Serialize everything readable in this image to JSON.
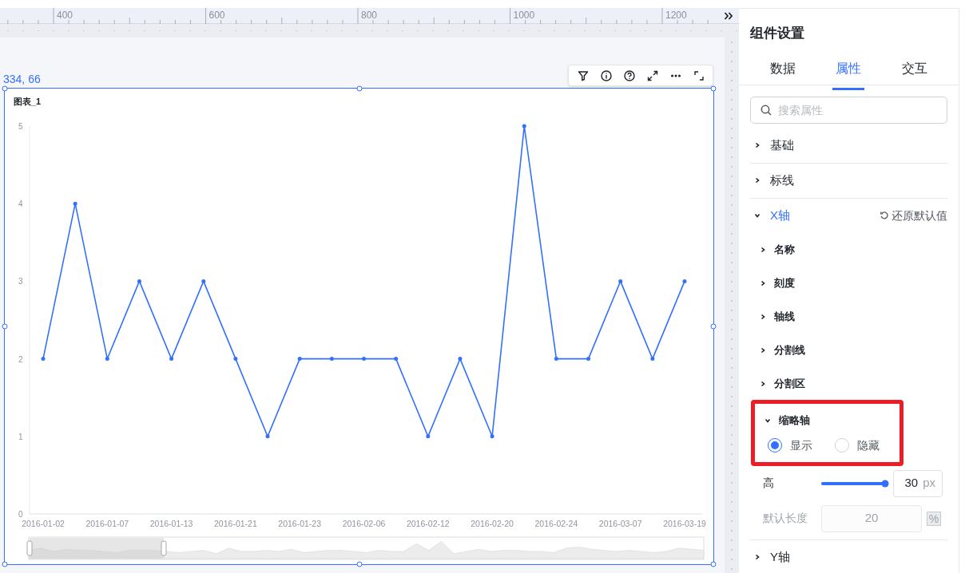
{
  "ruler": {
    "labels": [
      "400",
      "600",
      "800",
      "1000",
      "1200"
    ]
  },
  "canvas": {
    "coordinates": "334, 66"
  },
  "chart": {
    "title": "图表_1",
    "chart_data": {
      "type": "line",
      "categories": [
        "2016-01-02",
        null,
        "2016-01-07",
        null,
        "2016-01-13",
        null,
        "2016-01-21",
        null,
        "2016-01-23",
        null,
        "2016-02-06",
        null,
        "2016-02-12",
        null,
        "2016-02-20",
        null,
        "2016-02-24",
        null,
        "2016-03-07",
        null,
        "2016-03-19"
      ],
      "ylim": [
        0,
        5
      ],
      "yticks": [
        0,
        1,
        2,
        3,
        4,
        5
      ],
      "series": [
        {
          "color": "#3370ff",
          "values": [
            2,
            4,
            2,
            3,
            2,
            3,
            2,
            1,
            2,
            2,
            2,
            2,
            1,
            2,
            1,
            5,
            2,
            2,
            3,
            2,
            3
          ]
        }
      ]
    }
  },
  "panel": {
    "title": "组件设置",
    "tabs": [
      {
        "label": "数据",
        "selected": false
      },
      {
        "label": "属性",
        "selected": true
      },
      {
        "label": "交互",
        "selected": false
      }
    ],
    "search": {
      "placeholder": "搜索属性"
    },
    "sections": [
      {
        "label": "基础",
        "expanded": false
      },
      {
        "label": "标线",
        "expanded": false
      },
      {
        "label": "X轴",
        "expanded": true,
        "reset": "还原默认值",
        "children": [
          {
            "label": "名称",
            "expanded": false
          },
          {
            "label": "刻度",
            "expanded": false
          },
          {
            "label": "轴线",
            "expanded": false
          },
          {
            "label": "分割线",
            "expanded": false
          },
          {
            "label": "分割区",
            "expanded": false
          },
          {
            "label": "缩略轴",
            "expanded": true,
            "highlighted": true,
            "options": [
              {
                "label": "显示",
                "selected": true
              },
              {
                "label": "隐藏",
                "selected": false
              }
            ],
            "fields": [
              {
                "kind": "slider",
                "label": "高",
                "level": 1,
                "value": "30",
                "unit": "px",
                "disabled": false
              },
              {
                "kind": "input",
                "label": "默认长度",
                "value": "20",
                "unit": "%",
                "disabled": true
              }
            ]
          }
        ]
      },
      {
        "label": "Y轴",
        "expanded": false
      }
    ]
  }
}
